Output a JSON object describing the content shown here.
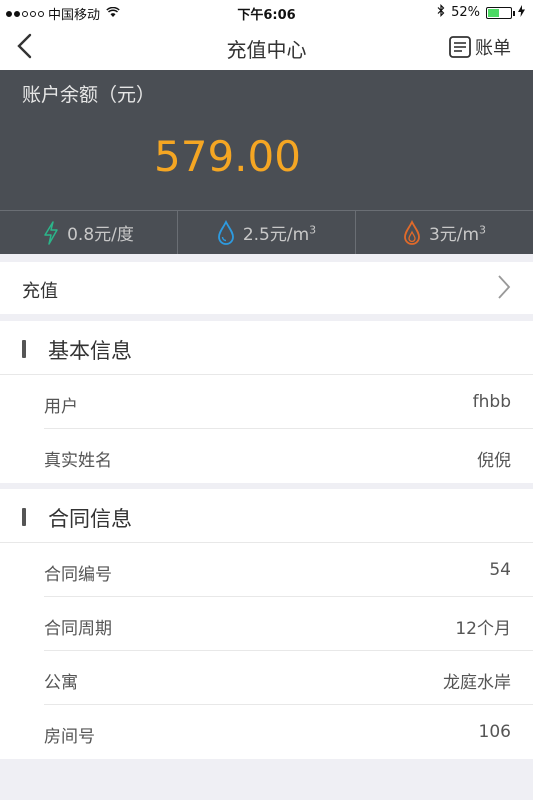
{
  "status_bar": {
    "carrier": "中国移动",
    "time": "下午6:06",
    "battery_text": "52%",
    "battery_level": 0.52
  },
  "nav": {
    "title": "充值中心",
    "bill_label": "账单"
  },
  "balance": {
    "label": "账户余额（元）",
    "amount": "579.00",
    "amount_color": "#f5a623",
    "bg_color": "#4a4e54"
  },
  "rates": [
    {
      "icon": "lightning-icon",
      "value": "0.8元/度",
      "unit_sup": ""
    },
    {
      "icon": "water-drop-icon",
      "value": "2.5元/m",
      "unit_sup": "3"
    },
    {
      "icon": "gas-flame-icon",
      "value": "3元/m",
      "unit_sup": "3"
    }
  ],
  "recharge": {
    "label": "充值"
  },
  "basic_info": {
    "title": "基本信息",
    "rows": [
      {
        "key": "用户",
        "value": "fhbb"
      },
      {
        "key": "真实姓名",
        "value": "倪倪"
      }
    ]
  },
  "contract_info": {
    "title": "合同信息",
    "rows": [
      {
        "key": "合同编号",
        "value": "54"
      },
      {
        "key": "合同周期",
        "value": "12个月"
      },
      {
        "key": "公寓",
        "value": "龙庭水岸"
      },
      {
        "key": "房间号",
        "value": "106"
      }
    ]
  }
}
